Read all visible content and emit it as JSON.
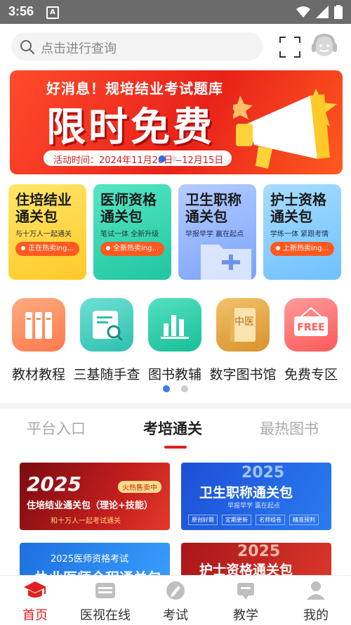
{
  "status_bar": {
    "time": "3:56",
    "a_icon": "A"
  },
  "search": {
    "placeholder": "点击进行查询"
  },
  "banner": {
    "headline": "好消息！规培结业考试题库",
    "big_text": "限时免费",
    "date_text": "活动时间：2024年11月20日—12月15日"
  },
  "cards": [
    {
      "title": "住培结业通关包",
      "subtitle": "与十万人一起通关",
      "pill": "正在热卖ing...",
      "bg": "#ffd84a",
      "pill_color": "#ff5a1f"
    },
    {
      "title": "医师资格通关包",
      "subtitle": "笔试一体 全新升级",
      "pill": "全新热卖ing...",
      "bg": "#3fd9b2",
      "pill_color": "#ff5a1f"
    },
    {
      "title": "卫生职称通关包",
      "subtitle": "早报早学 赢在起点",
      "pill": "",
      "bg": "#8fb8ff",
      "pill_color": "#ff5a1f"
    },
    {
      "title": "护士资格通关包",
      "subtitle": "学练一体 紧跟考情",
      "pill": "上新热卖ing...",
      "bg": "#8ed0ff",
      "pill_color": "#ff5a1f"
    }
  ],
  "quick": [
    {
      "label": "教材教程",
      "icon": "books-icon",
      "color": "#ff8a5c"
    },
    {
      "label": "三基随手查",
      "icon": "search-doc-icon",
      "color": "#47d0c0"
    },
    {
      "label": "图书教辅",
      "icon": "bar-chart-icon",
      "color": "#2fcfb0"
    },
    {
      "label": "数字图书馆",
      "icon": "library-book-icon",
      "color": "#e5a64a"
    },
    {
      "label": "免费专区",
      "icon": "free-sign-icon",
      "color": "#ff6b6b"
    }
  ],
  "book_icon_text": "中医",
  "free_sign_text": "FREE",
  "tabs": [
    {
      "label": "平台入口",
      "active": false
    },
    {
      "label": "考培通关",
      "active": true
    },
    {
      "label": "最热图书",
      "active": false
    }
  ],
  "promos": [
    {
      "year": "2025",
      "title": "住培结业通关包（理论+技能）",
      "tag": "火热售卖中",
      "slogan": "和十万人一起考试通关"
    },
    {
      "year": "2025",
      "title": "卫生职称通关包",
      "slogan": "早报早学  赢在起点",
      "chips": [
        "原创好题",
        "定期更新",
        "名师组卷",
        "精准预判"
      ]
    },
    {
      "title": "2025医师资格考试",
      "sub": "执业医师全程通关包"
    },
    {
      "year": "2025",
      "title": "护士资格通关包"
    }
  ],
  "bottom_nav": [
    {
      "label": "首页",
      "active": true,
      "icon": "graduation-cap-icon"
    },
    {
      "label": "医视在线",
      "active": false,
      "icon": "video-icon"
    },
    {
      "label": "考试",
      "active": false,
      "icon": "exam-icon"
    },
    {
      "label": "教学",
      "active": false,
      "icon": "teaching-icon"
    },
    {
      "label": "我的",
      "active": false,
      "icon": "profile-icon"
    }
  ],
  "colors": {
    "accent": "#e02020",
    "inactive": "#999999"
  }
}
